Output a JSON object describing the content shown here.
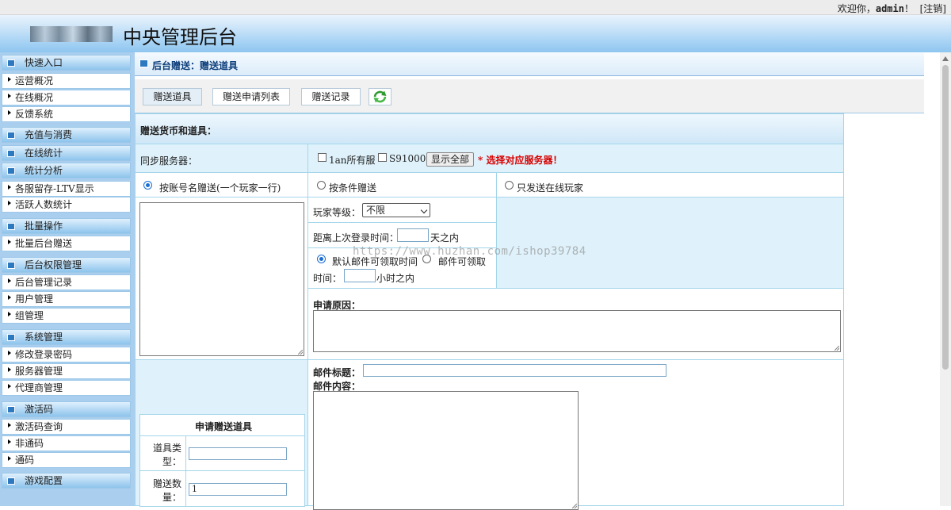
{
  "topbar": {
    "welcome_prefix": "欢迎你，",
    "username": "admin",
    "welcome_suffix": "！",
    "logout": "[注销]"
  },
  "header": {
    "title": "中央管理后台"
  },
  "sidebar": {
    "quick": {
      "title": "快速入口",
      "items": [
        "运营概况",
        "在线概况",
        "反馈系统"
      ]
    },
    "recharge": {
      "title": "充值与消费"
    },
    "online": {
      "title": "在线统计"
    },
    "stats": {
      "title": "统计分析",
      "items": [
        "各服留存-LTV显示",
        "活跃人数统计"
      ]
    },
    "batch": {
      "title": "批量操作",
      "items": [
        "批量后台赠送"
      ]
    },
    "perm": {
      "title": "后台权限管理",
      "items": [
        "后台管理记录",
        "用户管理",
        "组管理"
      ]
    },
    "system": {
      "title": "系统管理",
      "items": [
        "修改登录密码",
        "服务器管理",
        "代理商管理"
      ]
    },
    "codes": {
      "title": "激活码",
      "items": [
        "激活码查询",
        "非通码",
        "通码"
      ]
    },
    "game": {
      "title": "游戏配置"
    }
  },
  "breadcrumb": "后台赠送：赠送道具",
  "tabs": [
    "赠送道具",
    "赠送申请列表",
    "赠送记录"
  ],
  "form": {
    "section_title": "赠送货币和道具：",
    "sync_label": "同步服务器：",
    "server1": "1an所有服",
    "server2": "S910001",
    "show_all": "显示全部",
    "server_warning": "* 选择对应服务器！",
    "mode1": "按账号名赠送(一个玩家一行)",
    "mode2": "按条件赠送",
    "mode3": "只发送在线玩家",
    "level_label": "玩家等级：",
    "level_value": "不限",
    "last_login_label": "距离上次登录时间：",
    "last_login_unit": "天之内",
    "mail_opt1": "默认邮件可领取时间",
    "mail_opt2": "邮件可领取",
    "mail_time_label": "时间：",
    "mail_time_unit": "小时之内",
    "reason_label": "申请原因：",
    "mail_title_label": "邮件标题：",
    "mail_content_label": "邮件内容：",
    "item_section_title": "申请赠送道具",
    "item_type_label_1": "道具类",
    "item_type_label_2": "型：",
    "quantity_label_1": "赠送数",
    "quantity_label_2": "量：",
    "quantity_value": "1"
  },
  "watermark": "https://www.huzhan.com/ishop39784"
}
